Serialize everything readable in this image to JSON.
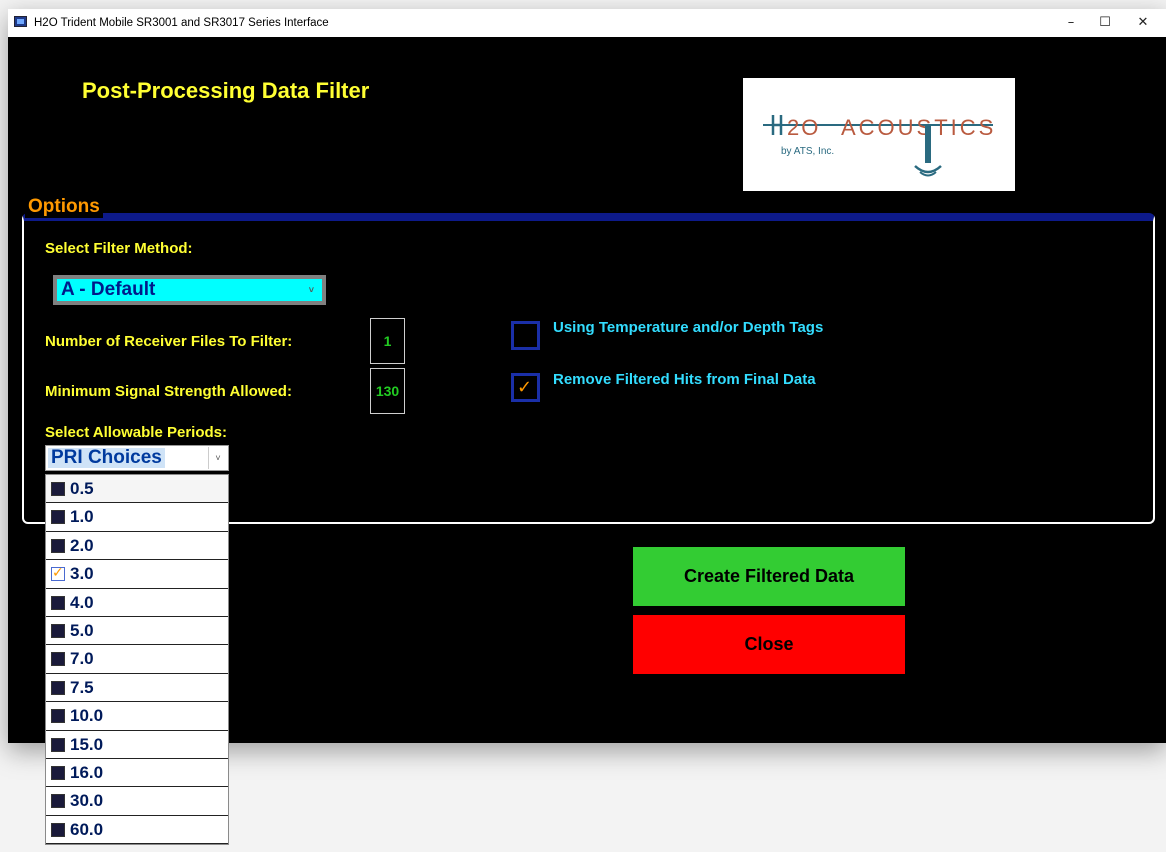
{
  "window": {
    "title": "H2O Trident Mobile SR3001 and SR3017 Series Interface",
    "controls": {
      "minimize": "–",
      "maximize": "☐",
      "close": "✕"
    }
  },
  "page": {
    "heading": "Post-Processing Data Filter"
  },
  "logo": {
    "main": "H2O ACOUSTICS",
    "sub": "by ATS, Inc."
  },
  "options": {
    "legend": "Options",
    "filter_method_label": "Select Filter Method:",
    "filter_method_value": "A - Default",
    "receiver_files_label": "Number of Receiver Files To Filter:",
    "receiver_files_value": "1",
    "min_signal_label": "Minimum Signal Strength Allowed:",
    "min_signal_value": "130",
    "periods_label": "Select Allowable Periods:",
    "temp_depth": {
      "label": "Using Temperature and/or Depth Tags",
      "checked": false
    },
    "remove_filtered": {
      "label": "Remove Filtered Hits from Final Data",
      "checked": true
    }
  },
  "pri": {
    "label": "PRI Choices",
    "items": [
      {
        "label": "0.5",
        "checked": false
      },
      {
        "label": "1.0",
        "checked": false
      },
      {
        "label": "2.0",
        "checked": false
      },
      {
        "label": "3.0",
        "checked": true
      },
      {
        "label": "4.0",
        "checked": false
      },
      {
        "label": "5.0",
        "checked": false
      },
      {
        "label": "7.0",
        "checked": false
      },
      {
        "label": "7.5",
        "checked": false
      },
      {
        "label": "10.0",
        "checked": false
      },
      {
        "label": "15.0",
        "checked": false
      },
      {
        "label": "16.0",
        "checked": false
      },
      {
        "label": "30.0",
        "checked": false
      },
      {
        "label": "60.0",
        "checked": false
      }
    ]
  },
  "buttons": {
    "create": "Create Filtered Data",
    "close": "Close"
  },
  "colors": {
    "background": "#000000",
    "heading": "#ffff33",
    "legend": "#ff9900",
    "value_text": "#22cc22",
    "checkbox_label": "#33ddff",
    "create_button": "#33cc33",
    "close_button": "#ff0000",
    "method_select": "#00ffff"
  }
}
